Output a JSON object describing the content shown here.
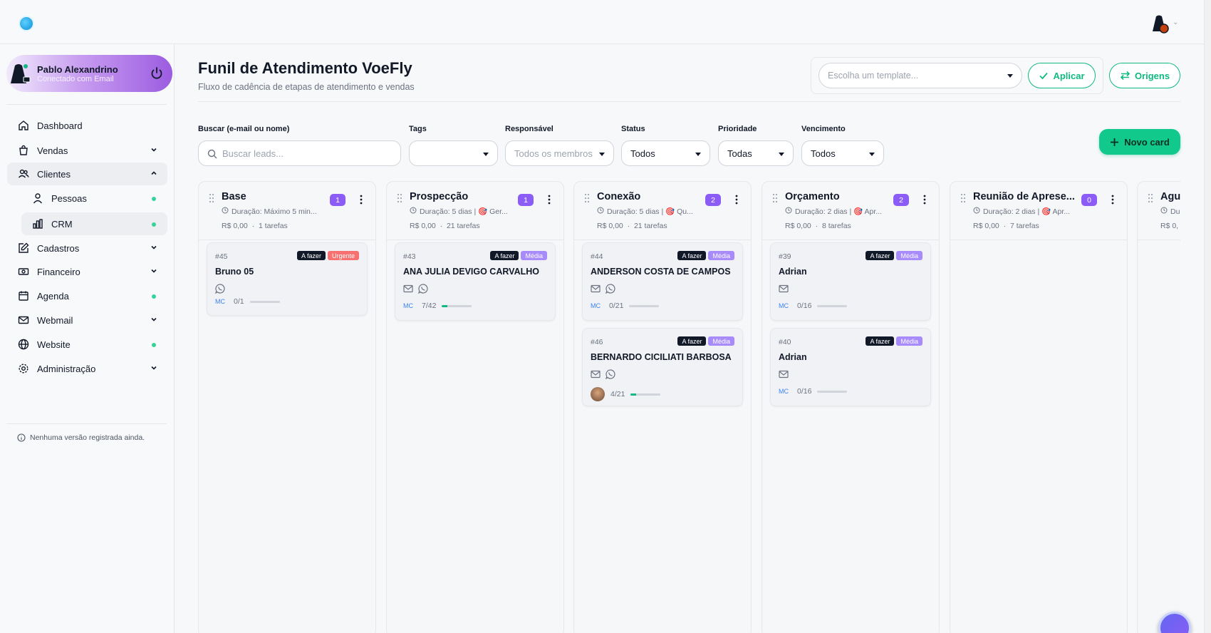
{
  "user": {
    "name": "Pablo Alexandrino",
    "status": "Conectado com Email"
  },
  "sidebar": {
    "items": [
      {
        "label": "Dashboard",
        "icon": "home-icon"
      },
      {
        "label": "Vendas",
        "icon": "shopping-bag-icon"
      },
      {
        "label": "Clientes",
        "icon": "users-icon"
      },
      {
        "label": "Pessoas",
        "icon": "user-icon"
      },
      {
        "label": "CRM",
        "icon": "bar-chart-icon"
      },
      {
        "label": "Cadastros",
        "icon": "edit-icon"
      },
      {
        "label": "Financeiro",
        "icon": "banknote-icon"
      },
      {
        "label": "Agenda",
        "icon": "calendar-icon"
      },
      {
        "label": "Webmail",
        "icon": "mail-icon"
      },
      {
        "label": "Website",
        "icon": "globe-icon"
      },
      {
        "label": "Administração",
        "icon": "settings-icon"
      }
    ],
    "version": "Nenhuma versão registrada ainda."
  },
  "header": {
    "title": "Funil de Atendimento VoeFly",
    "subtitle": "Fluxo de cadência de etapas de atendimento e vendas",
    "template_placeholder": "Escolha um template...",
    "apply_label": "Aplicar",
    "origins_label": "Origens"
  },
  "filters": {
    "search_label": "Buscar (e-mail ou nome)",
    "search_placeholder": "Buscar leads...",
    "tags_label": "Tags",
    "tags_value": "",
    "responsible_label": "Responsável",
    "responsible_value": "Todos os membros",
    "status_label": "Status",
    "status_value": "Todos",
    "priority_label": "Prioridade",
    "priority_value": "Todas",
    "due_label": "Vencimento",
    "due_value": "Todos",
    "new_card_label": "Novo card"
  },
  "columns": [
    {
      "title": "Base",
      "count": "1",
      "duration": "Duração: Máximo 5 min...",
      "amount": "R$ 0,00",
      "tasks": "1 tarefas",
      "cards": [
        {
          "id": "#45",
          "name": "Bruno 05",
          "badges": [
            "A fazer",
            "Urgente"
          ],
          "mc": "MC",
          "progress_text": "0/1",
          "progress": 0,
          "email": false,
          "whatsapp": true,
          "avatar": false
        }
      ]
    },
    {
      "title": "Prospecção",
      "count": "1",
      "duration": "Duração: 5 dias | 🎯 Ger...",
      "amount": "R$ 0,00",
      "tasks": "21 tarefas",
      "cards": [
        {
          "id": "#43",
          "name": "ANA JULIA DEVIGO CARVALHO",
          "badges": [
            "A fazer",
            "Média"
          ],
          "mc": "MC",
          "progress_text": "7/42",
          "progress": 0.17,
          "email": true,
          "whatsapp": true,
          "avatar": false
        }
      ]
    },
    {
      "title": "Conexão",
      "count": "2",
      "duration": "Duração: 5 dias | 🎯 Qu...",
      "amount": "R$ 0,00",
      "tasks": "21 tarefas",
      "cards": [
        {
          "id": "#44",
          "name": "ANDERSON COSTA DE CAMPOS",
          "badges": [
            "A fazer",
            "Média"
          ],
          "mc": "MC",
          "progress_text": "0/21",
          "progress": 0,
          "email": true,
          "whatsapp": true,
          "avatar": false
        },
        {
          "id": "#46",
          "name": "BERNARDO CICILIATI BARBOSA",
          "badges": [
            "A fazer",
            "Média"
          ],
          "mc": "",
          "progress_text": "4/21",
          "progress": 0.19,
          "email": true,
          "whatsapp": true,
          "avatar": true
        }
      ]
    },
    {
      "title": "Orçamento",
      "count": "2",
      "duration": "Duração: 2 dias | 🎯 Apr...",
      "amount": "R$ 0,00",
      "tasks": "8 tarefas",
      "cards": [
        {
          "id": "#39",
          "name": "Adrian",
          "badges": [
            "A fazer",
            "Média"
          ],
          "mc": "MC",
          "progress_text": "0/16",
          "progress": 0,
          "email": true,
          "whatsapp": false,
          "avatar": false
        },
        {
          "id": "#40",
          "name": "Adrian",
          "badges": [
            "A fazer",
            "Média"
          ],
          "mc": "MC",
          "progress_text": "0/16",
          "progress": 0,
          "email": true,
          "whatsapp": false,
          "avatar": false
        }
      ]
    },
    {
      "title": "Reunião de Aprese...",
      "count": "0",
      "duration": "Duração: 2 dias | 🎯 Apr...",
      "amount": "R$ 0,00",
      "tasks": "7 tarefas",
      "cards": []
    },
    {
      "title": "Agu",
      "count": "",
      "duration": "Dur",
      "amount": "R$ 0,",
      "tasks": "",
      "cards": []
    }
  ],
  "colors": {
    "accent": "#10b981",
    "purple": "#8b5cf6",
    "urgent": "#f87171"
  }
}
